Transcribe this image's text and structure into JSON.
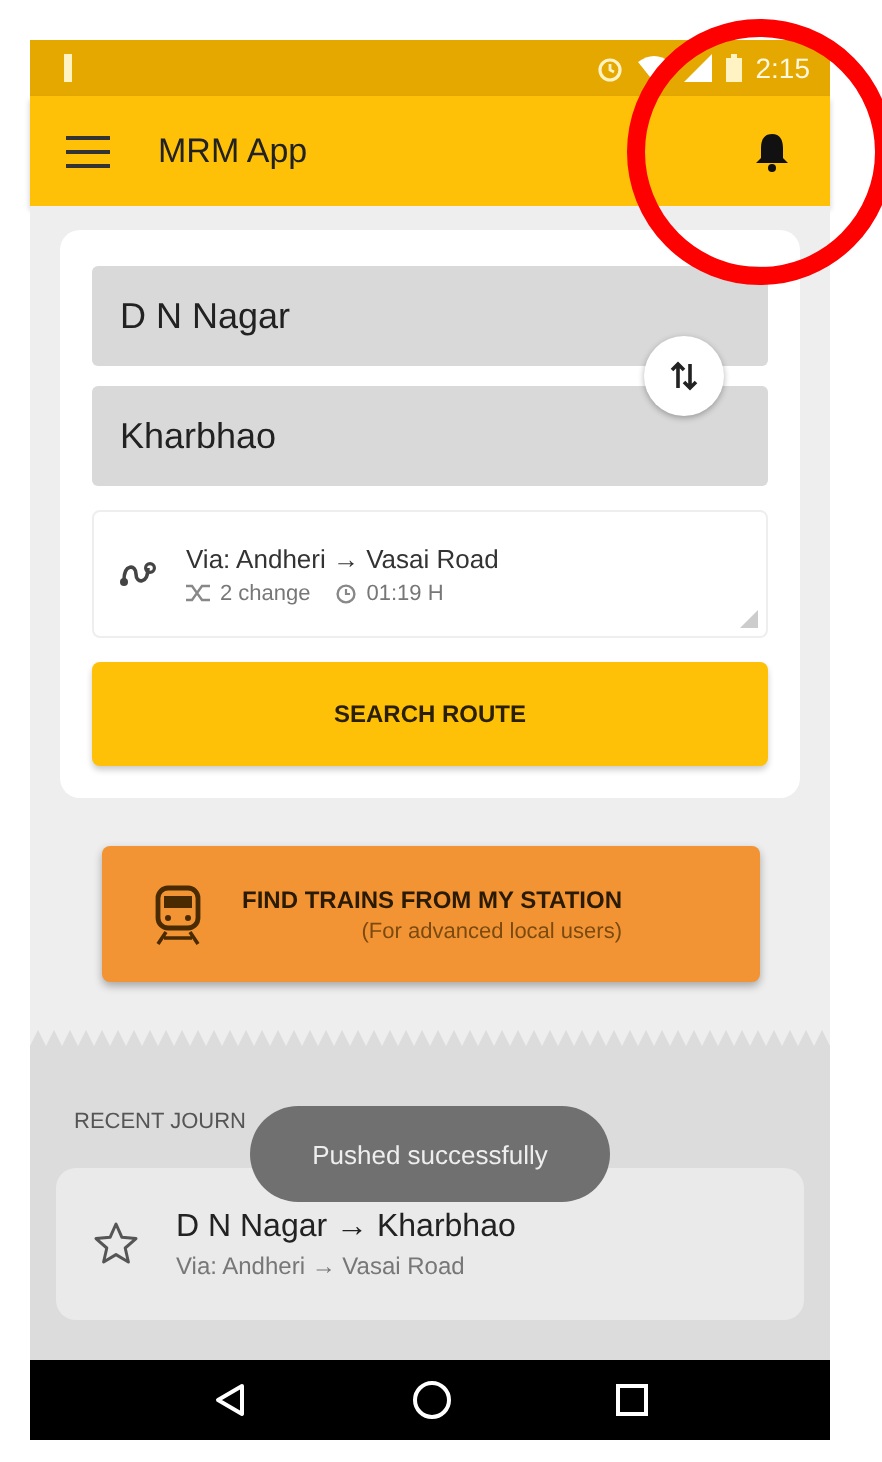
{
  "status_bar": {
    "time": "2:15"
  },
  "app_bar": {
    "title": "MRM App"
  },
  "route_form": {
    "from": "D N Nagar",
    "to": "Kharbhao",
    "via": "Via: Andheri → Vasai Road",
    "changes": "2 change",
    "duration": "01:19 H",
    "search_button": "SEARCH ROUTE"
  },
  "find_trains": {
    "title": "FIND TRAINS FROM MY STATION",
    "subtitle": "(For advanced local users)"
  },
  "recent": {
    "heading": "RECENT JOURN",
    "journeys": [
      {
        "route": "D N Nagar → Kharbhao",
        "via": "Via: Andheri → Vasai Road",
        "starred": false
      }
    ]
  },
  "toast": "Pushed successfully",
  "annotations": [
    {
      "kind": "circle"
    }
  ]
}
